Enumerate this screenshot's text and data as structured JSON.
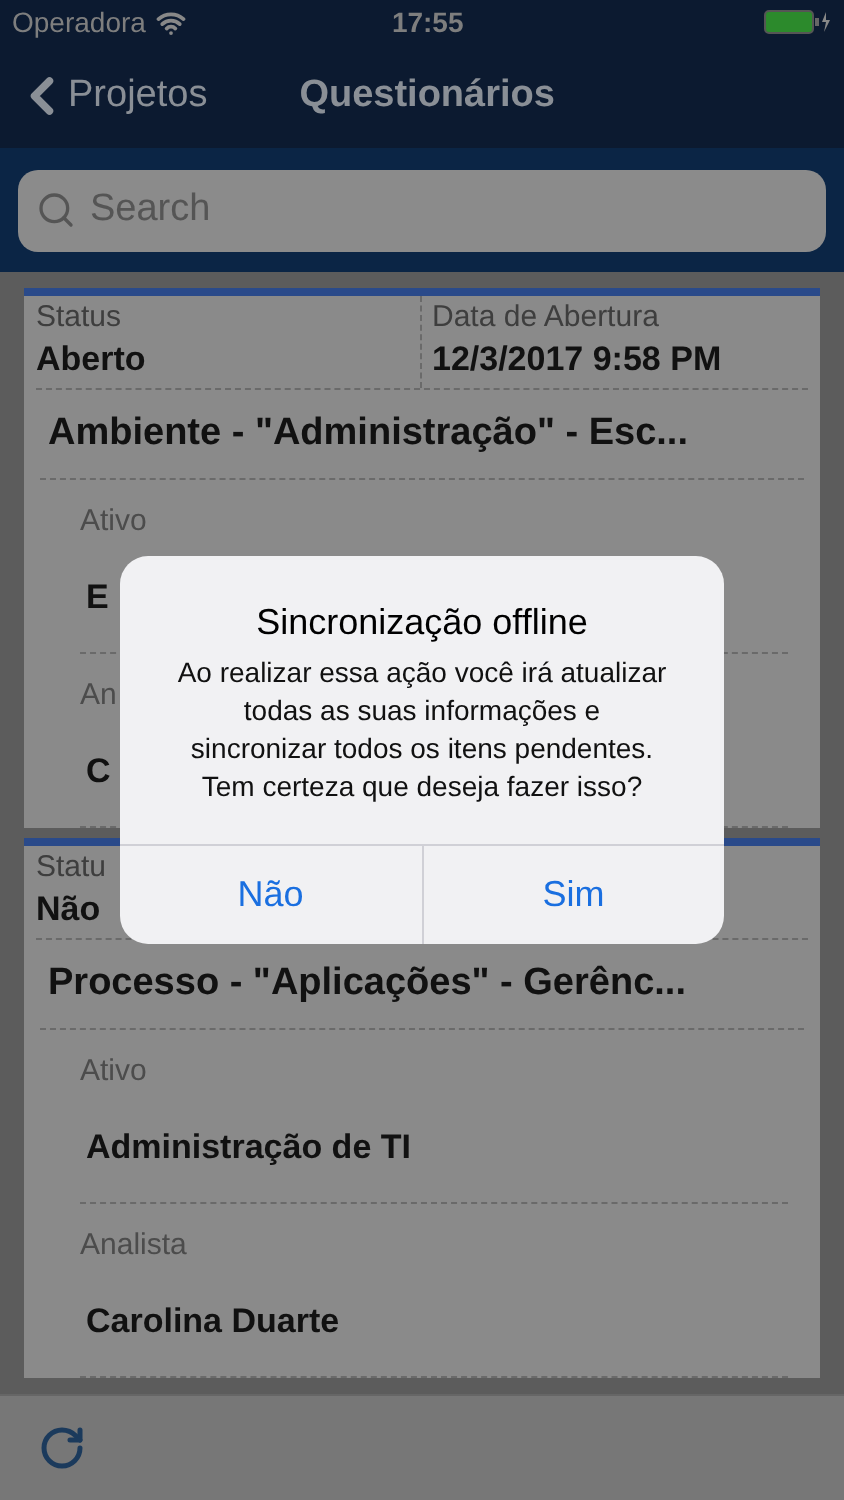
{
  "status_bar": {
    "carrier": "Operadora",
    "time": "17:55"
  },
  "nav": {
    "back": "Projetos",
    "title": "Questionários"
  },
  "search": {
    "placeholder": "Search"
  },
  "cards": [
    {
      "status_label": "Status",
      "status": "Aberto",
      "date_label": "Data de Abertura",
      "date": "12/3/2017 9:58 PM",
      "title": "Ambiente - \"Administração\" - Esc...",
      "fields": [
        {
          "label": "Ativo",
          "value": "E"
        },
        {
          "label": "An",
          "value": "C"
        }
      ]
    },
    {
      "status_label": "Statu",
      "status": "Não",
      "title": "Processo - \"Aplicações\" - Gerênc...",
      "fields": [
        {
          "label": "Ativo",
          "value": "Administração de TI"
        },
        {
          "label": "Analista",
          "value": "Carolina Duarte"
        }
      ]
    }
  ],
  "dialog": {
    "title": "Sincronização offline",
    "message": "Ao realizar essa ação você irá atualizar todas as suas informações e sincronizar todos os itens pendentes. Tem certeza que deseja fazer isso?",
    "buttons": [
      "Não",
      "Sim"
    ]
  }
}
